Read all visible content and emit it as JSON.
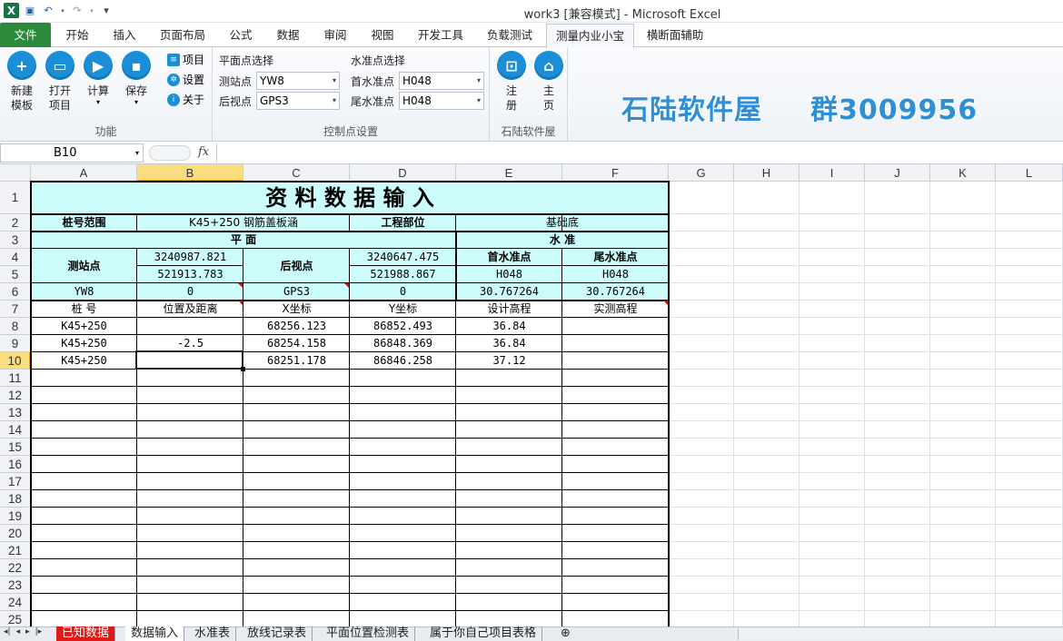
{
  "window": {
    "title": "work3  [兼容模式]  -  Microsoft Excel"
  },
  "qat": {
    "icons": [
      "excel-logo",
      "save-icon",
      "undo-icon",
      "redo-icon",
      "customize-icon"
    ]
  },
  "tabs": [
    "文件",
    "开始",
    "插入",
    "页面布局",
    "公式",
    "数据",
    "审阅",
    "视图",
    "开发工具",
    "负载测试",
    "测量内业小宝",
    "横断面辅助"
  ],
  "ribbon": {
    "group1": {
      "label": "功能",
      "buttons": [
        "新建\n模板",
        "打开\n项目",
        "计算",
        "保存"
      ],
      "small": [
        "项目",
        "设置",
        "关于"
      ]
    },
    "group2": {
      "label": "控制点设置",
      "plane_title": "平面点选择",
      "station_label": "测站点",
      "station_value": "YW8",
      "back_label": "后视点",
      "back_value": "GPS3",
      "level_title": "水准点选择",
      "first_label": "首水准点",
      "first_value": "H048",
      "last_label": "尾水准点",
      "last_value": "H048"
    },
    "group3": {
      "label": "石陆软件屋",
      "reg": "注\n册",
      "home": "主\n页"
    },
    "brand_left": "石陆软件屋",
    "brand_right": "群3009956"
  },
  "formula_bar": {
    "name_box": "B10",
    "fx": "fx",
    "value": ""
  },
  "columns": [
    "A",
    "B",
    "C",
    "D",
    "E",
    "F",
    "G",
    "H",
    "I",
    "J",
    "K",
    "L"
  ],
  "rows": [
    "1",
    "2",
    "3",
    "4",
    "5",
    "6",
    "7",
    "8",
    "9",
    "10",
    "11",
    "12",
    "13",
    "14",
    "15",
    "16",
    "17",
    "18",
    "19",
    "20",
    "21",
    "22",
    "23",
    "24",
    "25"
  ],
  "sheet": {
    "title": "资  料  数  据  输  入",
    "r2": {
      "a": "桩号范围",
      "bc": "K45+250  钢筋盖板涵",
      "d": "工程部位",
      "ef": "基础底"
    },
    "r3": {
      "ad": "平        面",
      "ef": "水        准"
    },
    "r4": {
      "a": "测站点",
      "b": "3240987.821",
      "c": "后视点",
      "d": "3240647.475",
      "e": "首水准点",
      "f": "尾水准点"
    },
    "r5": {
      "b": "521913.783",
      "d": "521988.867",
      "e": "H048",
      "f": "H048"
    },
    "r6": {
      "a": "YW8",
      "b": "0",
      "c": "GPS3",
      "d": "0",
      "e": "30.767264",
      "f": "30.767264"
    },
    "r7": {
      "a": "桩    号",
      "b": "位置及距离",
      "c": "X坐标",
      "d": "Y坐标",
      "e": "设计高程",
      "f": "实测高程"
    },
    "data_rows": [
      {
        "a": "K45+250",
        "b": "",
        "c": "68256.123",
        "d": "86852.493",
        "e": "36.84",
        "f": ""
      },
      {
        "a": "K45+250",
        "b": "-2.5",
        "c": "68254.158",
        "d": "86848.369",
        "e": "36.84",
        "f": ""
      },
      {
        "a": "K45+250",
        "b": "",
        "c": "68251.178",
        "d": "86846.258",
        "e": "37.12",
        "f": ""
      }
    ]
  },
  "sheet_tabs": [
    "已知数据",
    "数据输入",
    "水准表",
    "放线记录表",
    "平面位置检测表",
    "属于你自己项目表格"
  ],
  "colors": {
    "accent": "#1a8fd8",
    "file_tab": "#2c8a3c",
    "cyan_fill": "#cdfcfc",
    "selection": "#f9dd7e",
    "red_tab": "#e01919"
  }
}
